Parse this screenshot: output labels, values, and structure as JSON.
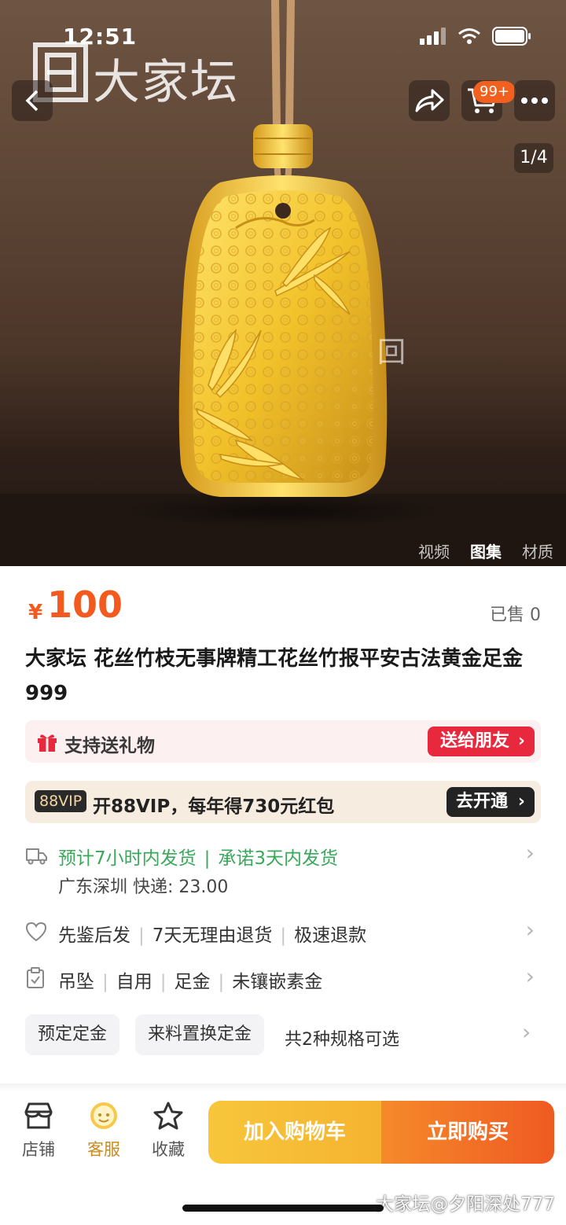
{
  "status_bar": {
    "time": "12:51"
  },
  "brand": {
    "logo_text": "大家坛"
  },
  "hero": {
    "image_counter": "1/4",
    "cart_badge": "99+",
    "media_tabs": [
      "视频",
      "图集",
      "材质"
    ],
    "active_tab_index": 1
  },
  "product": {
    "currency_symbol": "¥",
    "price": "100",
    "sold": "已售 0",
    "title": "大家坛 花丝竹枝无事牌精工花丝竹报平安古法黄金足金999"
  },
  "gift": {
    "label": "支持送礼物",
    "button": "送给朋友"
  },
  "vip": {
    "badge": "88VIP",
    "text": "开88VIP，每年得730元红包",
    "button": "去开通"
  },
  "shipping": {
    "estimate": "预计7小时内发货",
    "promise": "承诺3天内发货",
    "origin_fee": "广东深圳  快递: 23.00"
  },
  "services": [
    "先鉴后发",
    "7天无理由退货",
    "极速退款"
  ],
  "params": [
    "吊坠",
    "自用",
    "足金",
    "未镶嵌素金"
  ],
  "specs": {
    "options": [
      "预定定金",
      "来料置换定金"
    ],
    "count_text": "共2种规格可选"
  },
  "bottom_nav": {
    "store": "店铺",
    "service": "客服",
    "favorite": "收藏",
    "add_cart": "加入购物车",
    "buy_now": "立即购买"
  },
  "watermark": "大家坛@夕阳深处777",
  "colors": {
    "price": "#f25a1f",
    "gift_button": "#e8283d",
    "ship_green": "#3aa85a",
    "buy_orange": "#ef5a22",
    "cart_yellow": "#f5b330"
  }
}
